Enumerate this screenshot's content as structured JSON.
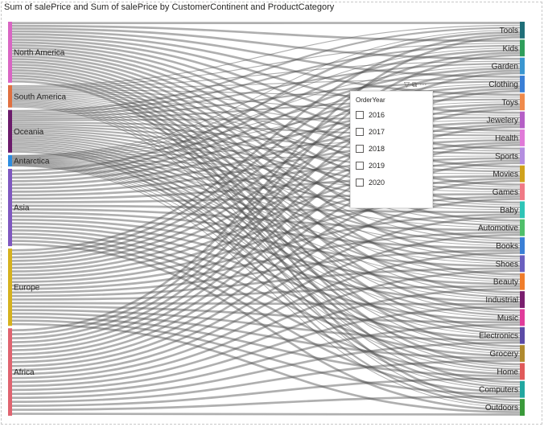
{
  "chart_title": "Sum of salePrice and Sum of salePrice by CustomerContinent and ProductCategory",
  "slicer": {
    "header": "OrderYear",
    "options": [
      "2016",
      "2017",
      "2018",
      "2019",
      "2020"
    ]
  },
  "icons": {
    "filter": "filter-icon",
    "focus": "focus-mode-icon",
    "more": "more-options-icon"
  },
  "chart_data": {
    "type": "sankey",
    "title": "Sum of salePrice and Sum of salePrice by CustomerContinent and ProductCategory",
    "sources": [
      {
        "name": "North America",
        "value": 15,
        "color": "#d966c4"
      },
      {
        "name": "South America",
        "value": 5.5,
        "color": "#e07040"
      },
      {
        "name": "Oceania",
        "value": 10.5,
        "color": "#6b1b6b"
      },
      {
        "name": "Antarctica",
        "value": 2.8,
        "color": "#2e8de0"
      },
      {
        "name": "Asia",
        "value": 19,
        "color": "#7f58c0"
      },
      {
        "name": "Europe",
        "value": 19,
        "color": "#d6b21e"
      },
      {
        "name": "Africa",
        "value": 21.5,
        "color": "#e06470"
      }
    ],
    "targets": [
      {
        "name": "Tools",
        "color": "#1f6f78"
      },
      {
        "name": "Kids",
        "color": "#2e9e5b"
      },
      {
        "name": "Garden",
        "color": "#3a96d0"
      },
      {
        "name": "Clothing",
        "color": "#3a7fd6"
      },
      {
        "name": "Toys",
        "color": "#f08a4b"
      },
      {
        "name": "Jewelery",
        "color": "#b55fc6"
      },
      {
        "name": "Health",
        "color": "#e07ad8"
      },
      {
        "name": "Sports",
        "color": "#b48ee0"
      },
      {
        "name": "Movies",
        "color": "#d0a21c"
      },
      {
        "name": "Games",
        "color": "#f07a86"
      },
      {
        "name": "Baby",
        "color": "#2ec4b6"
      },
      {
        "name": "Automotive",
        "color": "#4fbf6a"
      },
      {
        "name": "Books",
        "color": "#3a7fd6"
      },
      {
        "name": "Shoes",
        "color": "#6a5fbf"
      },
      {
        "name": "Beauty",
        "color": "#f07d2b"
      },
      {
        "name": "Industrial",
        "color": "#7a1e6e"
      },
      {
        "name": "Music",
        "color": "#e03c9a"
      },
      {
        "name": "Electronics",
        "color": "#5b4aa6"
      },
      {
        "name": "Grocery",
        "color": "#b08a2e"
      },
      {
        "name": "Home",
        "color": "#e05a5a"
      },
      {
        "name": "Computers",
        "color": "#21a7a0"
      },
      {
        "name": "Outdoors",
        "color": "#3a9a3a"
      }
    ]
  }
}
